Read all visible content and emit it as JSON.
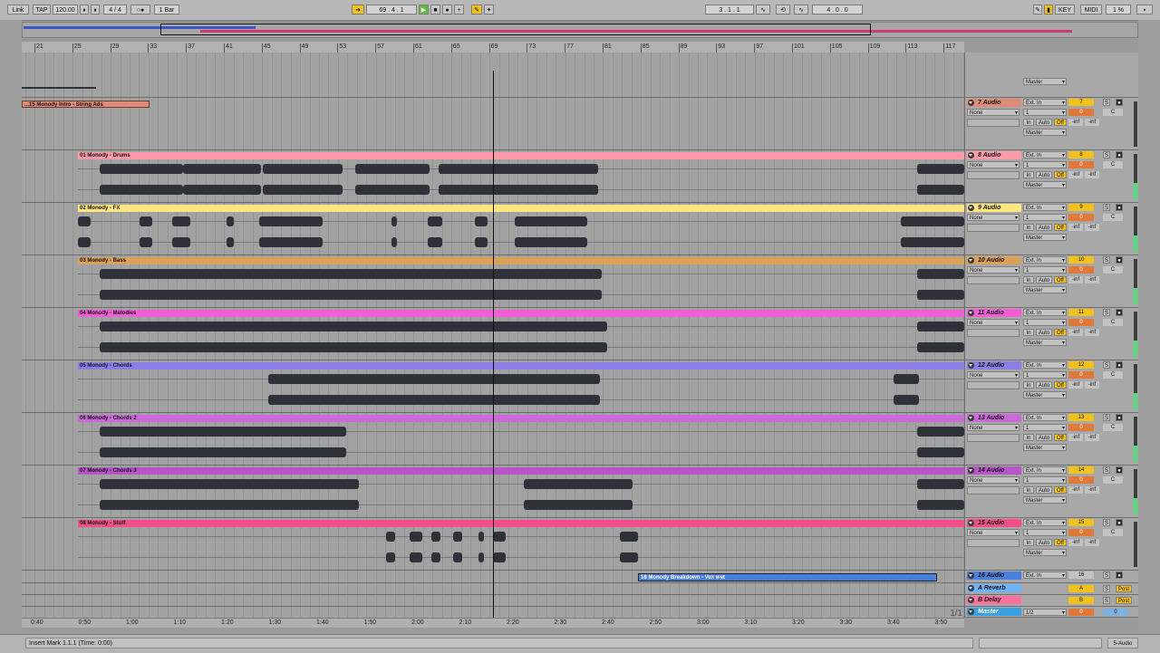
{
  "transport": {
    "link": "Link",
    "tap": "TAP",
    "tempo": "120.00",
    "signature": "4 / 4",
    "quantize": "1 Bar",
    "position": "69 . 4 . 1",
    "loop_start": "3 . 1 . 1",
    "loop_length": "4 . 0 . 0",
    "key": "KEY",
    "midi": "MIDI",
    "cpu": "1 %"
  },
  "ruler": {
    "bars": [
      "21",
      "25",
      "29",
      "33",
      "37",
      "41",
      "45",
      "49",
      "53",
      "57",
      "61",
      "65",
      "69",
      "73",
      "77",
      "81",
      "85",
      "89",
      "93",
      "97",
      "101",
      "105",
      "109",
      "113",
      "117"
    ]
  },
  "time_ruler": {
    "labels": [
      "0:40",
      "0:50",
      "1:00",
      "1:10",
      "1:20",
      "1:30",
      "1:40",
      "1:50",
      "2:00",
      "2:10",
      "2:20",
      "2:30",
      "2:40",
      "2:50",
      "3:00",
      "3:10",
      "3:20",
      "3:30",
      "3:40",
      "3:50"
    ],
    "page": "1/1"
  },
  "top_clip": {
    "name": "...15 Monody Intro - String Ads",
    "color": "#e08a78"
  },
  "bottom_clip": {
    "name": "18 Monody Breakdown - Vox wet",
    "color": "#4a7fe0"
  },
  "tracks": [
    {
      "number": "7",
      "name": "7 Audio",
      "color": "#e08a78",
      "clip": ""
    },
    {
      "number": "8",
      "name": "8 Audio",
      "color": "#ff9aa8",
      "clip": "01 Monody - Drums"
    },
    {
      "number": "9",
      "name": "9 Audio",
      "color": "#ffe680",
      "clip": "02 Monody - FX"
    },
    {
      "number": "10",
      "name": "10 Audio",
      "color": "#d9a15a",
      "clip": "03 Monody - Bass"
    },
    {
      "number": "11",
      "name": "11 Audio",
      "color": "#f25ed6",
      "clip": "04 Monody - Melodies"
    },
    {
      "number": "12",
      "name": "12 Audio",
      "color": "#8a7fe6",
      "clip": "05 Monody - Chords"
    },
    {
      "number": "13",
      "name": "13 Audio",
      "color": "#c96ad6",
      "clip": "06 Monody - Chords 2"
    },
    {
      "number": "14",
      "name": "14 Audio",
      "color": "#b856c9",
      "clip": "07 Monody - Chords 3"
    },
    {
      "number": "15",
      "name": "15 Audio",
      "color": "#f24e8a",
      "clip": "08 Monody - Stuff"
    },
    {
      "number": "16",
      "name": "16 Audio",
      "color": "#4a7fe0",
      "clip": ""
    }
  ],
  "returns": [
    {
      "name": "A Reverb",
      "letter": "A",
      "color": "#6fb3ff",
      "post": "Post"
    },
    {
      "name": "B Delay",
      "letter": "B",
      "color": "#ff6fa0",
      "post": "Post"
    }
  ],
  "master": {
    "name": "Master",
    "color": "#3aa0e0",
    "out": "1/2",
    "val": "0"
  },
  "io": {
    "ext_in": "Ext. In",
    "none": "None",
    "one": "1",
    "in": "In",
    "auto": "Auto",
    "off": "Off",
    "master": "Master",
    "zero": "0",
    "c": "C",
    "inf": "-inf",
    "s": "S"
  },
  "status": {
    "message": "Insert Mark 1.1.1 (Time: 0:00)",
    "track": "5-Audio"
  },
  "colors": {
    "accent": "#f2c21a",
    "playhead": "#111111",
    "waveform": "#2e3138"
  }
}
